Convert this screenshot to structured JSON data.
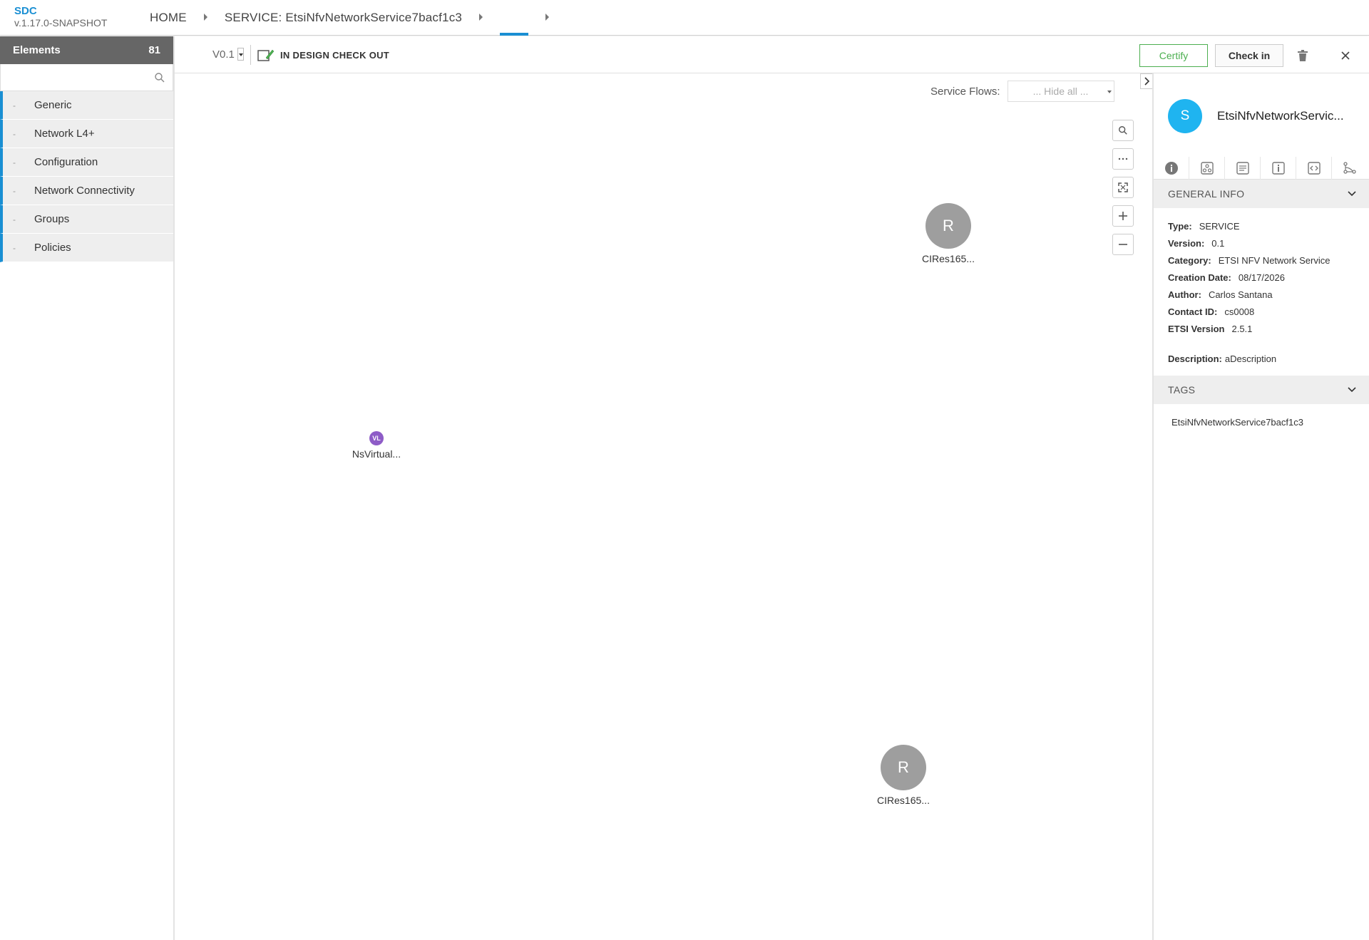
{
  "header": {
    "brand": "SDC",
    "version": "v.1.17.0-SNAPSHOT",
    "breadcrumbs": [
      "HOME",
      "SERVICE: EtsiNfvNetworkService7bacf1c3"
    ]
  },
  "sidebar": {
    "title": "Elements",
    "count": "81",
    "search_placeholder": "",
    "items": [
      {
        "label": "Generic"
      },
      {
        "label": "Network L4+"
      },
      {
        "label": "Configuration"
      },
      {
        "label": "Network Connectivity"
      },
      {
        "label": "Groups"
      },
      {
        "label": "Policies"
      }
    ]
  },
  "toolbar": {
    "version": "V0.1",
    "status": "IN DESIGN CHECK OUT",
    "certify_label": "Certify",
    "checkin_label": "Check in"
  },
  "canvas": {
    "service_flows_label": "Service Flows:",
    "service_flows_value": "... Hide all ...",
    "nodes": [
      {
        "letter": "R",
        "label": "CIRes165..."
      },
      {
        "letter": "VL",
        "label": "NsVirtual..."
      },
      {
        "letter": "R",
        "label": "CIRes165..."
      }
    ]
  },
  "details": {
    "avatar_letter": "S",
    "title": "EtsiNfvNetworkServic...",
    "general_info_title": "GENERAL INFO",
    "info": [
      {
        "key": "Type:",
        "value": "SERVICE"
      },
      {
        "key": "Version:",
        "value": "0.1"
      },
      {
        "key": "Category:",
        "value": "ETSI NFV Network Service"
      },
      {
        "key": "Creation Date:",
        "value": "08/17/2026"
      },
      {
        "key": "Author:",
        "value": "Carlos Santana"
      },
      {
        "key": "Contact ID:",
        "value": "cs0008"
      },
      {
        "key": "ETSI Version",
        "value": "2.5.1"
      }
    ],
    "description_key": "Description:",
    "description_value": "aDescription",
    "tags_title": "TAGS",
    "tags": [
      "EtsiNfvNetworkService7bacf1c3"
    ]
  },
  "colors": {
    "accent": "#1a8fd3",
    "certify": "#4caf50",
    "avatar": "#1fb4f0",
    "node": "#9e9e9e",
    "vl_node": "#8e5cc7"
  }
}
